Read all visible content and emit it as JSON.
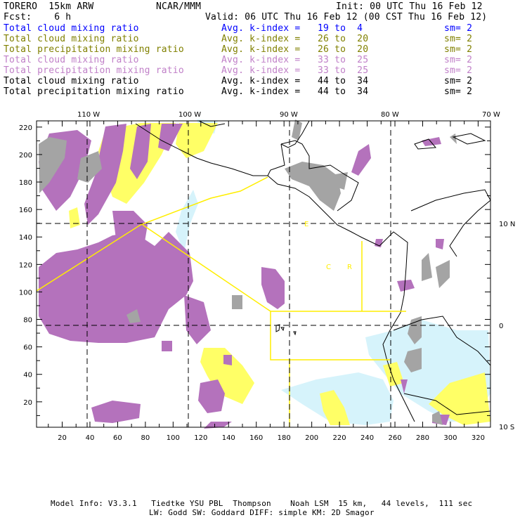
{
  "header": {
    "model": "TORERO  15km ARW",
    "org": "NCAR/MMM",
    "init": "Init: 00 UTC Thu 16 Feb 12",
    "fcst": "Fcst:    6 h",
    "valid": "Valid: 06 UTC Thu 16 Feb 12 (00 CST Thu 16 Feb 12)"
  },
  "legend": [
    {
      "field": "Total cloud mixing ratio",
      "kindex": "Avg. k-index =",
      "range": "19 to  4",
      "sm": "sm= 2",
      "color": "#0000ff"
    },
    {
      "field": "Total cloud mixing ratio",
      "kindex": "Avg. k-index =",
      "range": "26 to  20",
      "sm": "sm= 2",
      "color": "#808000"
    },
    {
      "field": "Total precipitation mixing ratio",
      "kindex": "Avg. k-index =",
      "range": "26 to  20",
      "sm": "sm= 2",
      "color": "#808000"
    },
    {
      "field": "Total cloud mixing ratio",
      "kindex": "Avg. k-index =",
      "range": "33 to  25",
      "sm": "sm= 2",
      "color": "#c080c8"
    },
    {
      "field": "Total precipitation mixing ratio",
      "kindex": "Avg. k-index =",
      "range": "33 to  25",
      "sm": "sm= 2",
      "color": "#c080c8"
    },
    {
      "field": "Total cloud mixing ratio",
      "kindex": "Avg. k-index =",
      "range": "44 to  34",
      "sm": "sm= 2",
      "color": "#000000"
    },
    {
      "field": "Total precipitation mixing ratio",
      "kindex": "Avg. k-index =",
      "range": "44 to  34",
      "sm": "sm= 2",
      "color": "#000000"
    }
  ],
  "map": {
    "x_ticks": [
      "20",
      "40",
      "60",
      "80",
      "100",
      "120",
      "140",
      "160",
      "180",
      "200",
      "220",
      "240",
      "260",
      "280",
      "300",
      "320"
    ],
    "y_ticks": [
      "20",
      "40",
      "60",
      "80",
      "100",
      "120",
      "140",
      "160",
      "180",
      "200",
      "220"
    ],
    "lon_labels": [
      "110 W",
      "100 W",
      "90 W",
      "80 W",
      "70 W"
    ],
    "lat_labels": [
      "10 N",
      "0",
      "10 S"
    ],
    "region_labels": [
      "E",
      "C",
      "R"
    ],
    "colors": {
      "purple": "#b472bc",
      "yellow": "#ffff66",
      "gray": "#a4a4a4",
      "lightblue": "#d6f3fb",
      "line": "#ffee00"
    }
  },
  "footer": {
    "line1": "Model Info: V3.3.1   Tiedtke YSU PBL  Thompson    Noah LSM  15 km,   44 levels,  111 sec",
    "line2": "LW: Godd SW: Goddard DIFF: simple KM: 2D Smagor"
  }
}
